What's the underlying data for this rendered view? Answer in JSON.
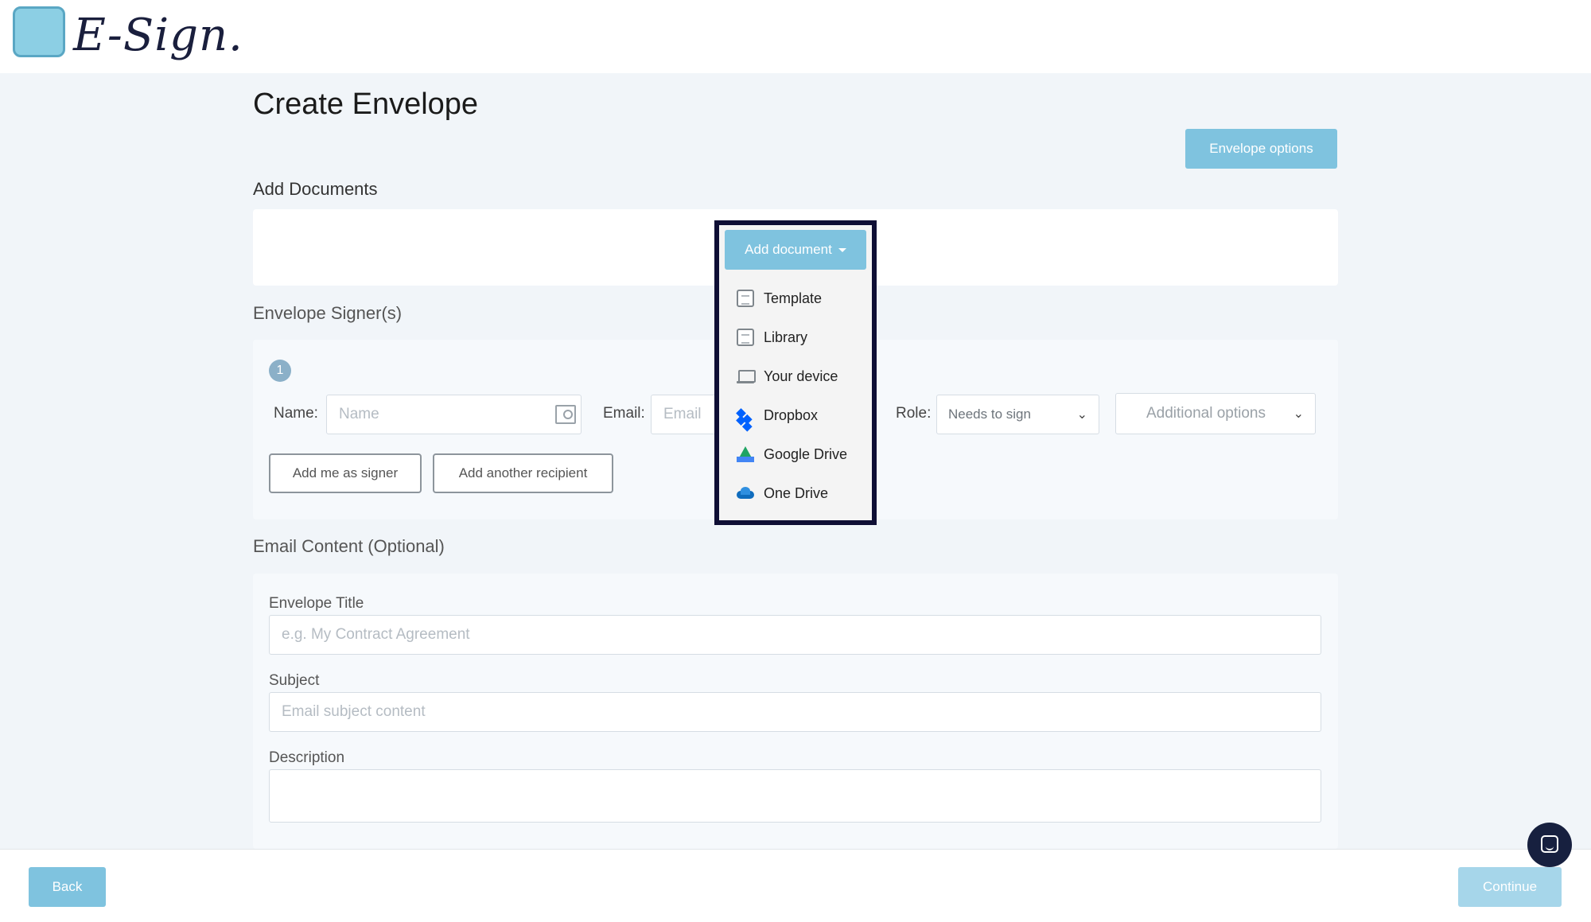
{
  "app": {
    "logo_text": "E-Sign."
  },
  "page": {
    "title": "Create Envelope"
  },
  "toolbar": {
    "envelope_options_label": "Envelope options"
  },
  "documents": {
    "section_label": "Add Documents",
    "add_button_label": "Add document",
    "menu": [
      {
        "label": "Template",
        "icon": "template-icon"
      },
      {
        "label": "Library",
        "icon": "library-icon"
      },
      {
        "label": "Your device",
        "icon": "laptop-icon"
      },
      {
        "label": "Dropbox",
        "icon": "dropbox-icon"
      },
      {
        "label": "Google Drive",
        "icon": "google-drive-icon"
      },
      {
        "label": "One Drive",
        "icon": "onedrive-icon"
      }
    ]
  },
  "signers": {
    "section_label": "Envelope Signer(s)",
    "step_number": "1",
    "name_label": "Name:",
    "name_placeholder": "Name",
    "email_label": "Email:",
    "email_placeholder": "Email",
    "role_label": "Role:",
    "role_value": "Needs to sign",
    "additional_options_label": "Additional options",
    "add_me_label": "Add me as signer",
    "add_another_label": "Add another recipient"
  },
  "email_content": {
    "section_label": "Email Content (Optional)",
    "title_label": "Envelope Title",
    "title_placeholder": "e.g. My Contract Agreement",
    "subject_label": "Subject",
    "subject_placeholder": "Email subject content",
    "description_label": "Description"
  },
  "footer": {
    "back_label": "Back",
    "continue_label": "Continue"
  },
  "colors": {
    "accent": "#7fc3df",
    "frame": "#0f0f35",
    "chat": "#17203f"
  }
}
